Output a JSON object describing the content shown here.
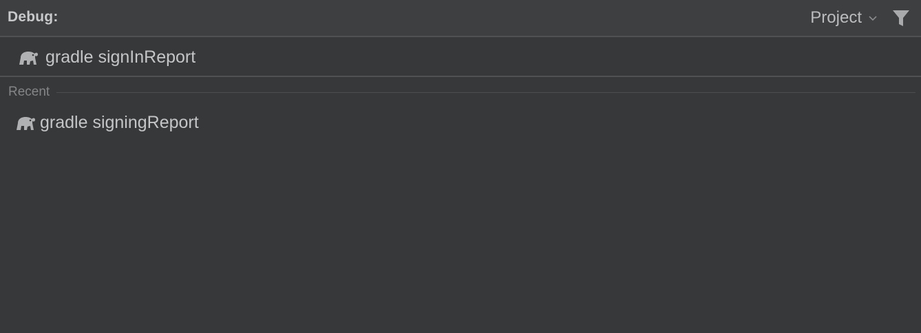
{
  "header": {
    "title": "Debug:",
    "scope_label": "Project",
    "scope_icon": "chevron-down-icon",
    "filter_icon": "filter-icon"
  },
  "input_row": {
    "icon": "gradle-elephant-icon",
    "text": "gradle signInReport"
  },
  "section": {
    "label": "Recent"
  },
  "recent_items": [
    {
      "icon": "gradle-elephant-icon",
      "text": "gradle signingReport"
    }
  ],
  "colors": {
    "background": "#37383a",
    "header_background": "#3d3f41",
    "divider": "#4f5153",
    "text": "#c4c5c6",
    "muted_text": "#838587",
    "icon": "#b0b1b2"
  }
}
